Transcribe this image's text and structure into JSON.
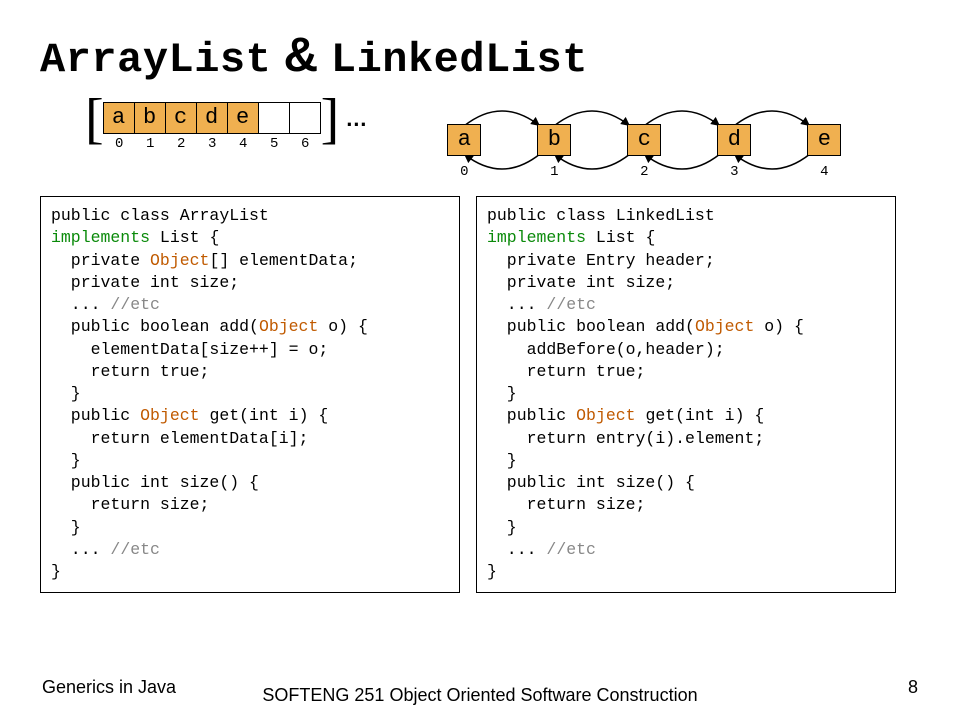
{
  "title": {
    "left": "ArrayList",
    "amp": "&",
    "right": "LinkedList"
  },
  "arraylist_diagram": {
    "cells": [
      "a",
      "b",
      "c",
      "d",
      "e",
      "",
      ""
    ],
    "filled": [
      true,
      true,
      true,
      true,
      true,
      false,
      false
    ],
    "indices": [
      "0",
      "1",
      "2",
      "3",
      "4",
      "5",
      "6"
    ],
    "ellipsis": "…"
  },
  "linkedlist_diagram": {
    "nodes": [
      "a",
      "b",
      "c",
      "d",
      "e"
    ],
    "indices": [
      "0",
      "1",
      "2",
      "3",
      "4"
    ]
  },
  "code_left": {
    "l1a": "public class ArrayList",
    "l2a": "implements",
    "l2b": " List {",
    "l3a": "  private ",
    "l3b": "Object",
    "l3c": "[] elementData;",
    "l4": "  private int size;",
    "l5a": "  ... ",
    "l5b": "//etc",
    "l6a": "  public boolean add(",
    "l6b": "Object",
    "l6c": " o) {",
    "l7": "    elementData[size++] = o;",
    "l8": "    return true;",
    "l9": "  }",
    "l10a": "  public ",
    "l10b": "Object",
    "l10c": " get(int i) {",
    "l11": "    return elementData[i];",
    "l12": "  }",
    "l13": "  public int size() {",
    "l14": "    return size;",
    "l15": "  }",
    "l16a": "  ... ",
    "l16b": "//etc",
    "l17": "}"
  },
  "code_right": {
    "l1a": "public class LinkedList",
    "l2a": "implements",
    "l2b": " List {",
    "l3": "  private Entry header;",
    "l4": "  private int size;",
    "l5a": "  ... ",
    "l5b": "//etc",
    "l6a": "  public boolean add(",
    "l6b": "Object",
    "l6c": " o) {",
    "l7": "    addBefore(o,header);",
    "l8": "    return true;",
    "l9": "  }",
    "l10a": "  public ",
    "l10b": "Object",
    "l10c": " get(int i) {",
    "l11": "    return entry(i).element;",
    "l12": "  }",
    "l13": "  public int size() {",
    "l14": "    return size;",
    "l15": "  }",
    "l16a": "  ... ",
    "l16b": "//etc",
    "l17": "}"
  },
  "footer": {
    "left": "Generics in Java",
    "center": "SOFTENG 251 Object Oriented Software Construction",
    "page": "8"
  }
}
